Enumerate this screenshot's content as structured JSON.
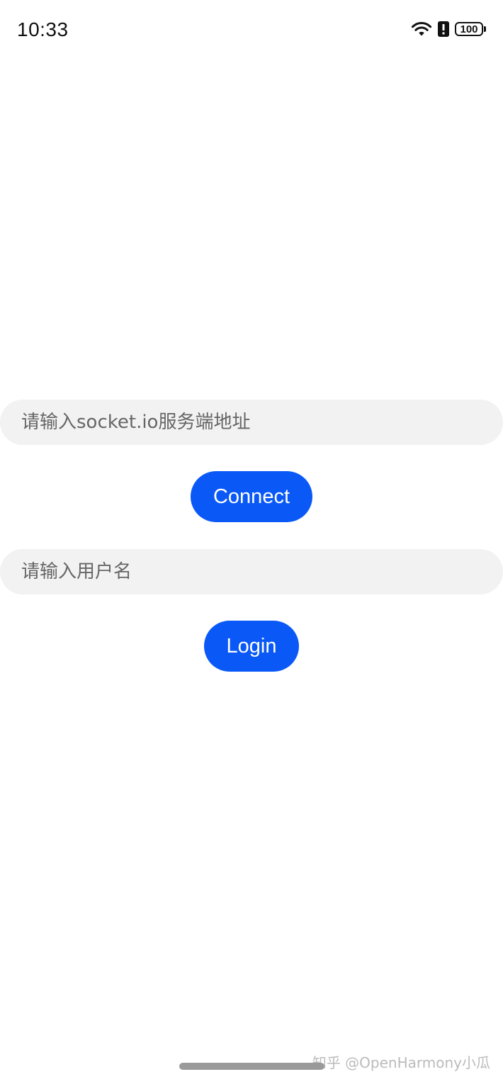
{
  "status_bar": {
    "time": "10:33",
    "battery_level": "100",
    "icons": [
      "wifi-icon",
      "alert-icon",
      "battery-icon"
    ]
  },
  "form": {
    "server_placeholder": "请输入socket.io服务端地址",
    "server_value": "",
    "connect_label": "Connect",
    "username_placeholder": "请输入用户名",
    "username_value": "",
    "login_label": "Login"
  },
  "watermark": "知乎 @OpenHarmony小瓜",
  "colors": {
    "accent": "#0a59f7",
    "field_background": "#f2f2f2",
    "placeholder": "#666666"
  }
}
